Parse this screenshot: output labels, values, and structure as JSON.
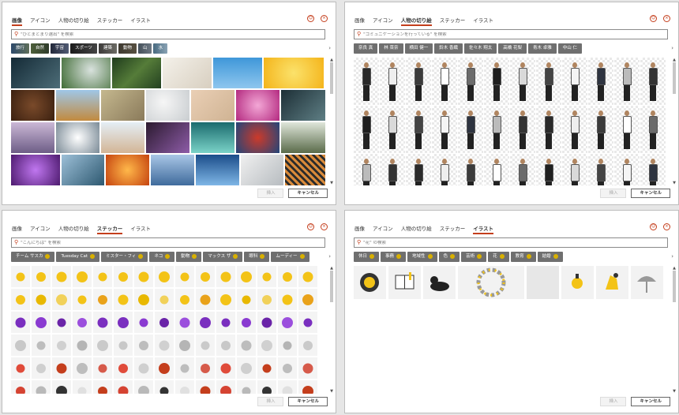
{
  "tabs": [
    "画像",
    "アイコン",
    "人物の切り絵",
    "ステッカー",
    "イラスト"
  ],
  "buttons": {
    "insert": "挿入",
    "cancel": "キャンセル"
  },
  "accent_color": "#c43e1c",
  "panels": [
    {
      "active_tab": "画像",
      "search_placeholder": "\"ひとまとまり選出\" を検索",
      "chips": [
        "旅行",
        "自然",
        "宇宙",
        "スポーツ",
        "建築",
        "動物",
        "山",
        "水"
      ]
    },
    {
      "active_tab": "人物の切り絵",
      "search_placeholder": "\"コミュニケーションを行っている\" を検索",
      "chips": [
        "奈良 真",
        "林 菜奈",
        "横田 健一",
        "鈴木 香織",
        "佐々木 翔太",
        "高橋 花梨",
        "青木 卓雅",
        "中山 仁"
      ]
    },
    {
      "active_tab": "ステッカー",
      "search_placeholder": "\"こんにちは\" を検索",
      "chips": [
        "チーム サスカ",
        "Tuesday Cat",
        "ミスター・フィ",
        "ネコ",
        "動物",
        "マックス ザ",
        "眼科",
        "ムーディー"
      ]
    },
    {
      "active_tab": "イラスト",
      "search_placeholder": "\"花\" の検索",
      "chips": [
        "休日",
        "事務",
        "地域性",
        "色",
        "芸術",
        "花",
        "教育",
        "結婚"
      ]
    }
  ]
}
